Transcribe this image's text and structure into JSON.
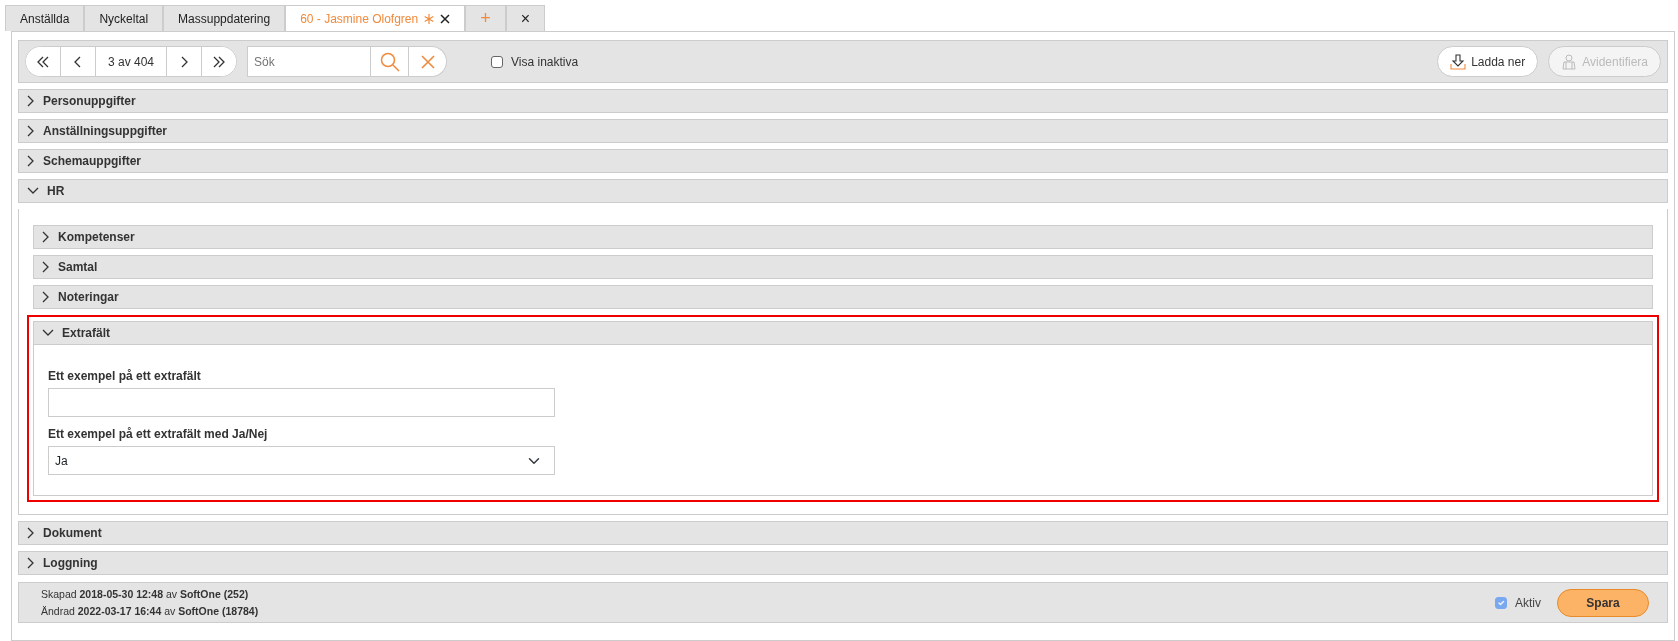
{
  "tabs": [
    {
      "label": "Anställda",
      "selected": false,
      "modified": false,
      "closable": false
    },
    {
      "label": "Nyckeltal",
      "selected": false,
      "modified": false,
      "closable": false
    },
    {
      "label": "Massuppdatering",
      "selected": false,
      "modified": false,
      "closable": false
    },
    {
      "label": "60 - Jasmine Olofgren",
      "selected": true,
      "modified": true,
      "closable": true
    }
  ],
  "tab_actions": [
    {
      "kind": "add",
      "text": "+"
    },
    {
      "kind": "close",
      "text": "×"
    }
  ],
  "toolbar": {
    "position": "3 av 404",
    "search": {
      "placeholder": "Sök"
    },
    "show_inactive": {
      "label": "Visa inaktiva",
      "checked": false
    },
    "buttons": [
      {
        "label": "Ladda ner",
        "kind": "download",
        "disabled": false
      },
      {
        "label": "Avidentifiera",
        "kind": "anonymize",
        "disabled": true
      }
    ]
  },
  "sections": [
    {
      "title": "Personuppgifter",
      "expanded": false
    },
    {
      "title": "Anställningsuppgifter",
      "expanded": false
    },
    {
      "title": "Schemauppgifter",
      "expanded": false
    },
    {
      "title": "HR",
      "expanded": true,
      "children": [
        {
          "title": "Kompetenser",
          "expanded": false
        },
        {
          "title": "Samtal",
          "expanded": false
        },
        {
          "title": "Noteringar",
          "expanded": false
        },
        {
          "title": "Extrafält",
          "expanded": true,
          "highlighted": true,
          "fields": [
            {
              "kind": "text",
              "label": "Ett exempel på ett extrafält"
            },
            {
              "kind": "select",
              "label": "Ett exempel på ett extrafält med Ja/Nej",
              "value": "Ja"
            }
          ]
        }
      ]
    },
    {
      "title": "Dokument",
      "expanded": false
    },
    {
      "title": "Loggning",
      "expanded": false
    }
  ],
  "footer": {
    "created": "Skapad **2018-05-30 12:48** av **SoftOne (252)**",
    "changed": "Ändrad **2022-03-17 16:44** av **SoftOne (18784)**",
    "active": {
      "label": "Aktiv",
      "checked": true,
      "disabled": true
    },
    "save_button": "Spara"
  }
}
